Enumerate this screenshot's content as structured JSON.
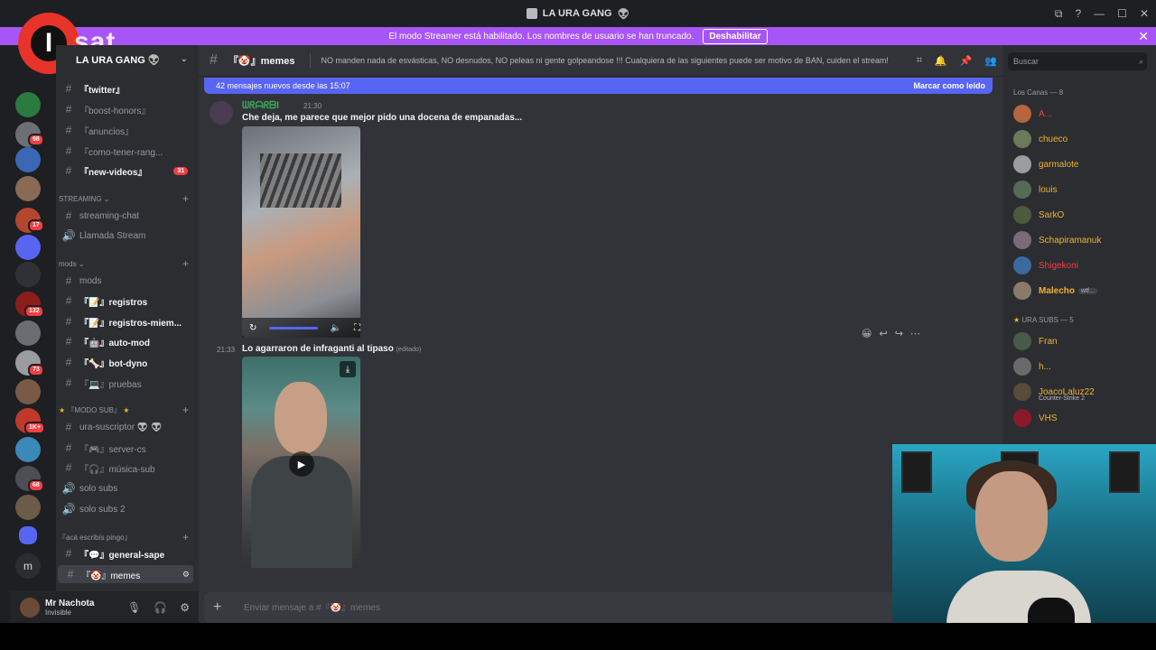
{
  "window": {
    "title": "LA URA GANG",
    "controls": [
      "⧉",
      "?",
      "—",
      "☐",
      "✕"
    ]
  },
  "overlay_logo": {
    "mark": "I",
    "text": "sat"
  },
  "banner": {
    "text": "El modo Streamer está habilitado. Los nombres de usuario se han truncado.",
    "button": "Deshabilitar",
    "close": "✕"
  },
  "server_rail": {
    "badges": [
      "7",
      "98",
      "17",
      "132",
      "73",
      "1K+",
      "68"
    ]
  },
  "sidebar": {
    "server_name": "LA URA GANG",
    "channels_top": [
      {
        "name": "『twitter』",
        "unread": true
      },
      {
        "name": "『boost-honors』",
        "unread": false
      },
      {
        "name": "『anuncios』",
        "unread": false
      },
      {
        "name": "『como-tener-rang...",
        "unread": false
      },
      {
        "name": "『new-videos』",
        "unread": true,
        "count": "31"
      }
    ],
    "cat_streaming": "STREAMING",
    "channels_streaming": [
      {
        "name": "streaming-chat",
        "icon": "#"
      },
      {
        "name": "Llamada Stream",
        "icon": "🔊"
      }
    ],
    "cat_mods": "mods",
    "channels_mods": [
      {
        "name": "mods",
        "unread": false
      },
      {
        "name": "『📝』registros",
        "unread": true
      },
      {
        "name": "『📝』registros-miem...",
        "unread": true
      },
      {
        "name": "『🤖』auto-mod",
        "unread": true
      },
      {
        "name": "『🦴』bot-dyno",
        "unread": true
      },
      {
        "name": "『💻』pruebas",
        "unread": false
      }
    ],
    "cat_modo_sub": "『MODO SUB』",
    "channels_sub": [
      {
        "name": "ura-suscriptor 👽 👽",
        "icon": "#"
      },
      {
        "name": "『🎮』server-cs",
        "icon": "#"
      },
      {
        "name": "『🎧』música-sub",
        "icon": "#"
      },
      {
        "name": "solo subs",
        "icon": "🔊"
      },
      {
        "name": "solo subs 2",
        "icon": "🔊"
      }
    ],
    "cat_aca": "『acá escribís pingo』",
    "channels_aca": [
      {
        "name": "『💬』general-sape",
        "unread": true
      },
      {
        "name": "『🤡』memes",
        "active": true
      }
    ]
  },
  "user": {
    "name": "Mr Nachota",
    "status": "Invisible"
  },
  "chat": {
    "channel": "『🤡』memes",
    "topic": "NO manden nada de esvásticas, NO desnudos, NO peleas ni gente golpeandose !!! Cualquiera de las siguientes puede ser motivo de BAN, cuiden el stream!",
    "new_messages": "42 mensajes nuevos desde las 15:07",
    "mark_read": "Marcar como leído",
    "messages": [
      {
        "author": "ᗯᖇᗩᖇᗷI",
        "time": "21:30",
        "text": "Che deja, me parece que mejor pido una docena de empanadas..."
      },
      {
        "time": "21:33",
        "text": "Lo agarraron de infraganti al tipaso",
        "edited": "(editado)"
      }
    ],
    "composer_placeholder": "Enviar mensaje a #『🤡』memes"
  },
  "members": {
    "search_placeholder": "Buscar",
    "group1": "Los Canas — 8",
    "group1_members": [
      {
        "name": "A...",
        "color": "#f23f43"
      },
      {
        "name": "chueco",
        "color": "#f0b232"
      },
      {
        "name": "garmalote",
        "color": "#f0b232"
      },
      {
        "name": "louis",
        "color": "#f0b232"
      },
      {
        "name": "SarkO",
        "color": "#f0b232"
      },
      {
        "name": "Schapiramanuk",
        "color": "#f0b232"
      },
      {
        "name": "Shigekoni",
        "color": "#f23f43"
      },
      {
        "name": "Malecho",
        "color": "#f0b232",
        "tag": "wtf..."
      }
    ],
    "group2": "URA SUBS — 5",
    "group2_members": [
      {
        "name": "Fran",
        "color": "#f0b232"
      },
      {
        "name": "h...",
        "color": "#f0b232"
      },
      {
        "name": "JoacoLaluz22",
        "color": "#f0b232",
        "sub": "Counter-Strike 2"
      },
      {
        "name": "VHS",
        "color": "#f0b232"
      }
    ]
  }
}
